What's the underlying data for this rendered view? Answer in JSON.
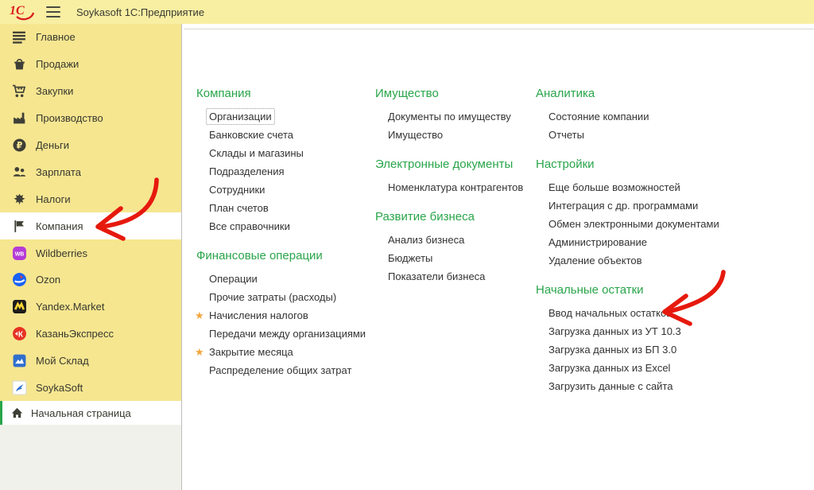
{
  "colors": {
    "topbar_yellow": "#f8efa3",
    "sidebar_yellow": "#f6e690",
    "green": "#29a54a",
    "star_orange": "#f2a63c",
    "arrow_red": "#e6190e",
    "logo_red": "#da1f1f"
  },
  "titlebar": {
    "logo_text": "1С",
    "title": "Soykasoft 1С:Предприятие"
  },
  "sidebar": {
    "items": [
      {
        "id": "glavnoe",
        "label": "Главное",
        "icon": "menu-lines"
      },
      {
        "id": "prodazhi",
        "label": "Продажи",
        "icon": "basket"
      },
      {
        "id": "zakupki",
        "label": "Закупки",
        "icon": "cart"
      },
      {
        "id": "proizvodstvo",
        "label": "Производство",
        "icon": "factory"
      },
      {
        "id": "dengi",
        "label": "Деньги",
        "icon": "ruble-coin"
      },
      {
        "id": "zarplata",
        "label": "Зарплата",
        "icon": "people"
      },
      {
        "id": "nalogi",
        "label": "Налоги",
        "icon": "eagle"
      },
      {
        "id": "kompaniya",
        "label": "Компания",
        "icon": "flag",
        "active": true
      },
      {
        "id": "wildberries",
        "label": "Wildberries",
        "icon": "wb-badge"
      },
      {
        "id": "ozon",
        "label": "Ozon",
        "icon": "ozon-badge"
      },
      {
        "id": "yandex-market",
        "label": "Yandex.Market",
        "icon": "yandex-badge"
      },
      {
        "id": "kazanexpress",
        "label": "КазаньЭкспресс",
        "icon": "kazan-badge"
      },
      {
        "id": "moysklad",
        "label": "Мой Склад",
        "icon": "moysklad-badge"
      },
      {
        "id": "soykasoft",
        "label": "SoykaSoft",
        "icon": "soyka-badge"
      }
    ],
    "home_label": "Начальная страница"
  },
  "content": {
    "columns": [
      {
        "sections": [
          {
            "title": "Компания",
            "items": [
              {
                "label": "Организации",
                "focused": true
              },
              {
                "label": "Банковские счета"
              },
              {
                "label": "Склады и магазины"
              },
              {
                "label": "Подразделения"
              },
              {
                "label": "Сотрудники"
              },
              {
                "label": "План счетов"
              },
              {
                "label": "Все справочники"
              }
            ]
          },
          {
            "title": "Финансовые операции",
            "items": [
              {
                "label": "Операции"
              },
              {
                "label": "Прочие затраты (расходы)"
              },
              {
                "label": "Начисления налогов",
                "star": true
              },
              {
                "label": "Передачи между организациями"
              },
              {
                "label": "Закрытие месяца",
                "star": true
              },
              {
                "label": "Распределение общих затрат"
              }
            ]
          }
        ]
      },
      {
        "sections": [
          {
            "title": "Имущество",
            "items": [
              {
                "label": "Документы по имуществу"
              },
              {
                "label": "Имущество"
              }
            ]
          },
          {
            "title": "Электронные документы",
            "items": [
              {
                "label": "Номенклатура контрагентов"
              }
            ]
          },
          {
            "title": "Развитие бизнеса",
            "items": [
              {
                "label": "Анализ бизнеса"
              },
              {
                "label": "Бюджеты"
              },
              {
                "label": "Показатели бизнеса"
              }
            ]
          }
        ]
      },
      {
        "sections": [
          {
            "title": "Аналитика",
            "items": [
              {
                "label": "Состояние компании"
              },
              {
                "label": "Отчеты"
              }
            ]
          },
          {
            "title": "Настройки",
            "items": [
              {
                "label": "Еще больше возможностей"
              },
              {
                "label": "Интеграция с др. программами"
              },
              {
                "label": "Обмен электронными документами"
              },
              {
                "label": "Администрирование"
              },
              {
                "label": "Удаление объектов"
              }
            ]
          },
          {
            "title": "Начальные остатки",
            "items": [
              {
                "label": "Ввод начальных остатков"
              },
              {
                "label": "Загрузка данных из УТ 10.3"
              },
              {
                "label": "Загрузка данных из БП 3.0"
              },
              {
                "label": "Загрузка данных из Excel"
              },
              {
                "label": "Загрузить данные с сайта"
              }
            ]
          }
        ]
      }
    ]
  },
  "annotations": {
    "arrows": [
      {
        "target": "Компания"
      },
      {
        "target": "Ввод начальных остатков"
      }
    ]
  }
}
